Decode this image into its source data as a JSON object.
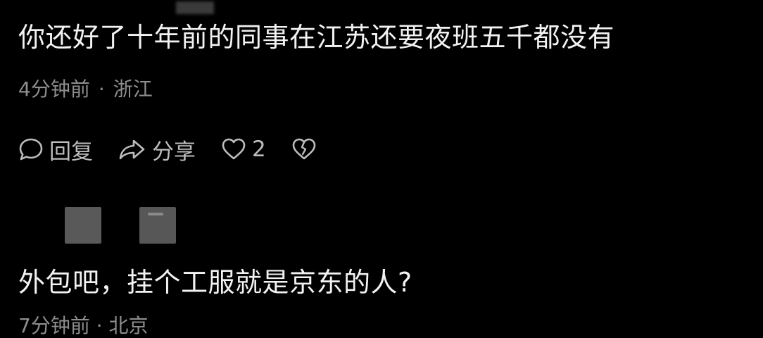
{
  "comment1": {
    "text": "你还好了十年前的同事在江苏还要夜班五千都没有",
    "time": "4分钟前",
    "separator": "·",
    "location": "浙江"
  },
  "actions": {
    "reply_label": "回复",
    "share_label": "分享",
    "like_count": "2"
  },
  "comment2": {
    "text": "外包吧，挂个工服就是京东的人?",
    "meta_partial": "7分钟前 · 北京"
  },
  "colors": {
    "background": "#000000",
    "primary_text": "#f2f2f2",
    "meta_text": "#8e8e8e",
    "icon": "#bdbdbd"
  }
}
